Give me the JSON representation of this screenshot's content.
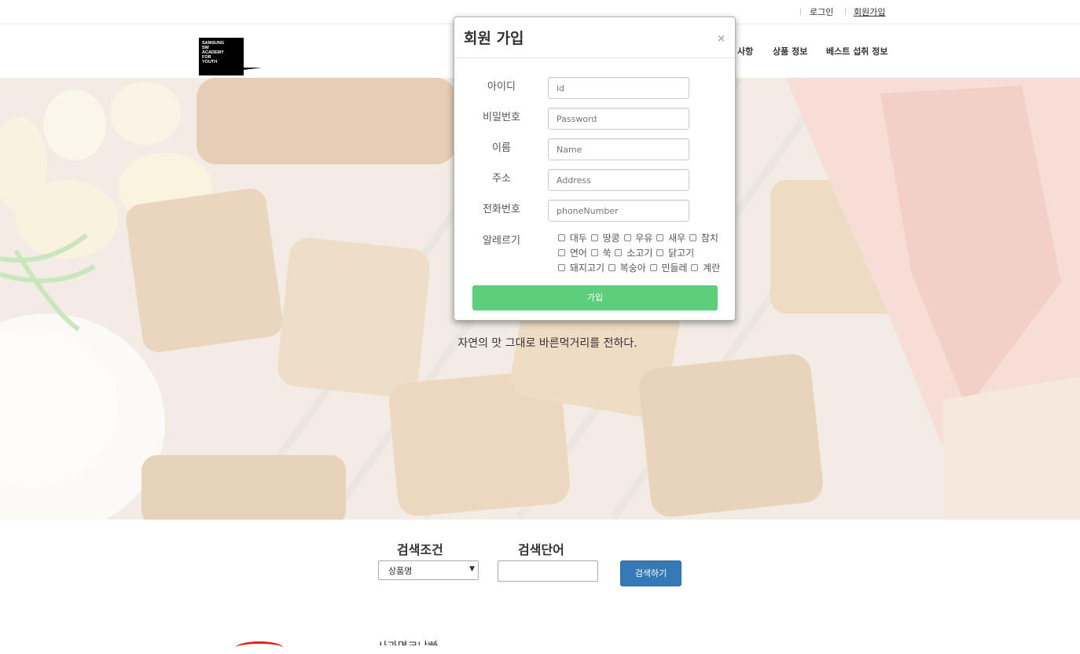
{
  "topbar": {
    "login_label": "로그인",
    "signup_label": "회원가입"
  },
  "logo": {
    "text": "SAMSUNG\nSW\nACADEMY\nFOR\nYOUTH"
  },
  "nav": {
    "items": [
      "사항",
      "상품 정보",
      "베스트 섭취 정보"
    ]
  },
  "hero": {
    "tagline": "자연의 맛 그대로 바른먹거리를 전하다."
  },
  "search": {
    "condition_label": "검색조건",
    "keyword_label": "검색단어",
    "selected_condition": "상품명",
    "keyword_value": "",
    "submit_label": "검색하기"
  },
  "bottom_peek_text": "사과면크냐빠",
  "modal": {
    "title": "회원 가입",
    "close_label": "×",
    "fields": [
      {
        "label": "아이디",
        "placeholder": "id"
      },
      {
        "label": "비밀번호",
        "placeholder": "Password"
      },
      {
        "label": "이름",
        "placeholder": "Name"
      },
      {
        "label": "주소",
        "placeholder": "Address"
      },
      {
        "label": "전화번호",
        "placeholder": "phoneNumber"
      }
    ],
    "allergy_label": "알레르기",
    "allergies": [
      "대두",
      "땅콩",
      "우유",
      "새우",
      "참치",
      "연어",
      "쑥",
      "소고기",
      "닭고기",
      "돼지고기",
      "복숭아",
      "민들레",
      "계란"
    ],
    "submit_label": "가입"
  },
  "colors": {
    "join_button": "#5cce7c",
    "search_button": "#337ab7"
  }
}
